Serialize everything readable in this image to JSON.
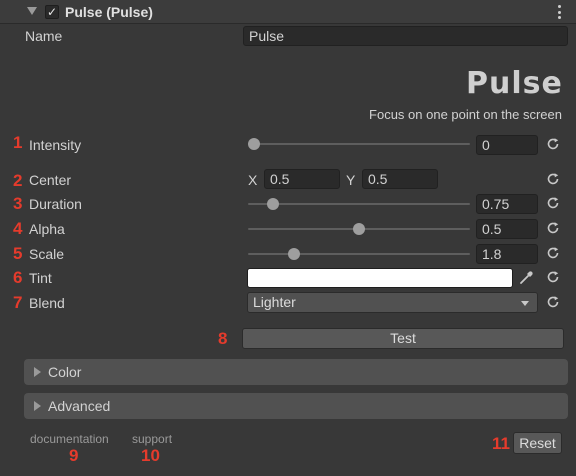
{
  "header": {
    "title": "Pulse (Pulse)",
    "enabled": true
  },
  "name_field": {
    "label": "Name",
    "value": "Pulse"
  },
  "logo": {
    "text": "Pulse"
  },
  "tagline": "Focus on one point on the screen",
  "properties": {
    "intensity": {
      "number": "1",
      "label": "Intensity",
      "value": "0",
      "slider_fraction": 0.0
    },
    "center": {
      "number": "2",
      "label": "Center",
      "x_label": "X",
      "x_value": "0.5",
      "y_label": "Y",
      "y_value": "0.5"
    },
    "duration": {
      "number": "3",
      "label": "Duration",
      "value": "0.75",
      "slider_fraction": 0.09
    },
    "alpha": {
      "number": "4",
      "label": "Alpha",
      "value": "0.5",
      "slider_fraction": 0.5
    },
    "scale": {
      "number": "5",
      "label": "Scale",
      "value": "1.8",
      "slider_fraction": 0.19
    },
    "tint": {
      "number": "6",
      "label": "Tint",
      "color": "#ffffff"
    },
    "blend": {
      "number": "7",
      "label": "Blend",
      "value": "Lighter"
    }
  },
  "test_button": {
    "number": "8",
    "label": "Test"
  },
  "foldouts": [
    {
      "label": "Color"
    },
    {
      "label": "Advanced"
    }
  ],
  "footer": {
    "documentation": {
      "label": "documentation",
      "number": "9"
    },
    "support": {
      "label": "support",
      "number": "10"
    },
    "reset": {
      "label": "Reset",
      "number": "11"
    }
  },
  "colors": {
    "annotation": "#e53b2c",
    "background": "#383838"
  }
}
